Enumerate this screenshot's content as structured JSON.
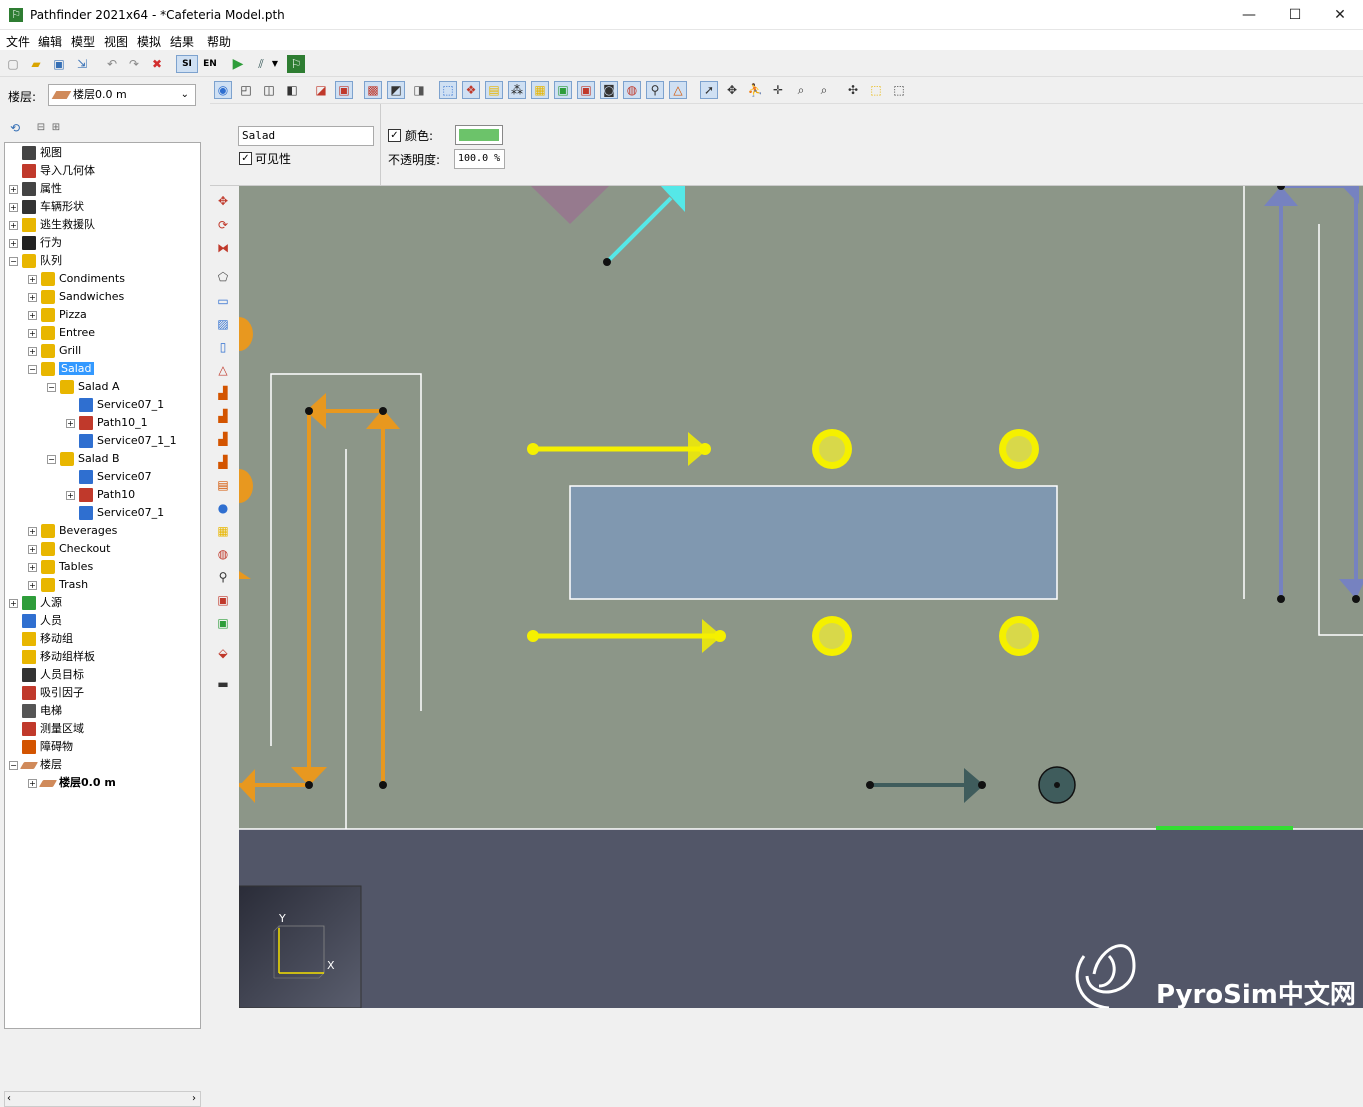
{
  "window": {
    "title": "Pathfinder  2021x64 - *Cafeteria Model.pth",
    "minimize": "—",
    "maximize": "☐",
    "close": "✕"
  },
  "menu": [
    "文件",
    "编辑",
    "模型",
    "视图",
    "模拟",
    "结果",
    "帮助"
  ],
  "toolbar1": {
    "si_label": "SI",
    "en_label": "EN"
  },
  "floor_selector": {
    "label": "楼层:",
    "value": "楼层0.0 m"
  },
  "tree": [
    {
      "label": "视图",
      "icon": "view-icon",
      "level": 0,
      "expander": ""
    },
    {
      "label": "导入几何体",
      "icon": "import-geometry-icon",
      "level": 0,
      "expander": ""
    },
    {
      "label": "属性",
      "icon": "properties-icon",
      "level": 0,
      "expander": "+"
    },
    {
      "label": "车辆形状",
      "icon": "wheelchair-icon",
      "level": 0,
      "expander": "+"
    },
    {
      "label": "逃生救援队",
      "icon": "rescue-team-icon",
      "level": 0,
      "expander": "+"
    },
    {
      "label": "行为",
      "icon": "behavior-icon",
      "level": 0,
      "expander": "+"
    },
    {
      "label": "队列",
      "icon": "queue-icon",
      "level": 0,
      "expander": "−"
    },
    {
      "label": "Condiments",
      "icon": "queue-icon",
      "level": 1,
      "expander": "+"
    },
    {
      "label": "Sandwiches",
      "icon": "queue-icon",
      "level": 1,
      "expander": "+"
    },
    {
      "label": "Pizza",
      "icon": "queue-icon",
      "level": 1,
      "expander": "+"
    },
    {
      "label": "Entree",
      "icon": "queue-icon",
      "level": 1,
      "expander": "+"
    },
    {
      "label": "Grill",
      "icon": "queue-icon",
      "level": 1,
      "expander": "+"
    },
    {
      "label": "Salad",
      "icon": "queue-icon",
      "level": 1,
      "expander": "−",
      "selected": true
    },
    {
      "label": "Salad A",
      "icon": "queue-icon",
      "level": 2,
      "expander": "−"
    },
    {
      "label": "Service07_1",
      "icon": "service-point-icon",
      "level": 3,
      "expander": ""
    },
    {
      "label": "Path10_1",
      "icon": "path-icon",
      "level": 3,
      "expander": "+"
    },
    {
      "label": "Service07_1_1",
      "icon": "service-point-icon",
      "level": 3,
      "expander": ""
    },
    {
      "label": "Salad B",
      "icon": "queue-icon",
      "level": 2,
      "expander": "−"
    },
    {
      "label": "Service07",
      "icon": "service-point-icon",
      "level": 3,
      "expander": ""
    },
    {
      "label": "Path10",
      "icon": "path-icon",
      "level": 3,
      "expander": "+"
    },
    {
      "label": "Service07_1",
      "icon": "service-point-icon",
      "level": 3,
      "expander": ""
    },
    {
      "label": "Beverages",
      "icon": "queue-icon",
      "level": 1,
      "expander": "+"
    },
    {
      "label": "Checkout",
      "icon": "queue-icon",
      "level": 1,
      "expander": "+"
    },
    {
      "label": "Tables",
      "icon": "queue-icon",
      "level": 1,
      "expander": "+"
    },
    {
      "label": "Trash",
      "icon": "queue-icon",
      "level": 1,
      "expander": "+"
    },
    {
      "label": "人源",
      "icon": "occupant-source-icon",
      "level": 0,
      "expander": "+"
    },
    {
      "label": "人员",
      "icon": "occupants-icon",
      "level": 0,
      "expander": ""
    },
    {
      "label": "移动组",
      "icon": "movement-group-icon",
      "level": 0,
      "expander": ""
    },
    {
      "label": "移动组样板",
      "icon": "movement-template-icon",
      "level": 0,
      "expander": ""
    },
    {
      "label": "人员目标",
      "icon": "occupant-target-icon",
      "level": 0,
      "expander": ""
    },
    {
      "label": "吸引因子",
      "icon": "magnet-icon",
      "level": 0,
      "expander": ""
    },
    {
      "label": "电梯",
      "icon": "elevator-icon",
      "level": 0,
      "expander": ""
    },
    {
      "label": "测量区域",
      "icon": "measurement-region-icon",
      "level": 0,
      "expander": ""
    },
    {
      "label": "障碍物",
      "icon": "obstruction-cone-icon",
      "level": 0,
      "expander": ""
    },
    {
      "label": "楼层",
      "icon": "floor-icon",
      "level": 0,
      "expander": "−"
    },
    {
      "label": "楼层0.0 m",
      "icon": "floor-icon",
      "level": 1,
      "expander": "+",
      "bold": true
    }
  ],
  "properties": {
    "name_value": "Salad",
    "visibility_label": "可见性",
    "visibility_checked": true,
    "color_label": "颜色:",
    "color_checked": true,
    "color_value": "#6cc36a",
    "opacity_label": "不透明度:",
    "opacity_value": "100.0 %"
  },
  "axes": {
    "x": "X",
    "y": "Y"
  },
  "watermark": "PyroSim中文网",
  "colors": {
    "floor": "#8c9688",
    "outside": "#525668",
    "accent_orange": "#e8981f",
    "service_yellow": "#f5f000",
    "counter": "#8098b0",
    "path_blue": "#7682c0",
    "cyan_arrow": "#55e8e8",
    "dark_teal": "#3f5c5c",
    "green_line": "#33dd33"
  }
}
